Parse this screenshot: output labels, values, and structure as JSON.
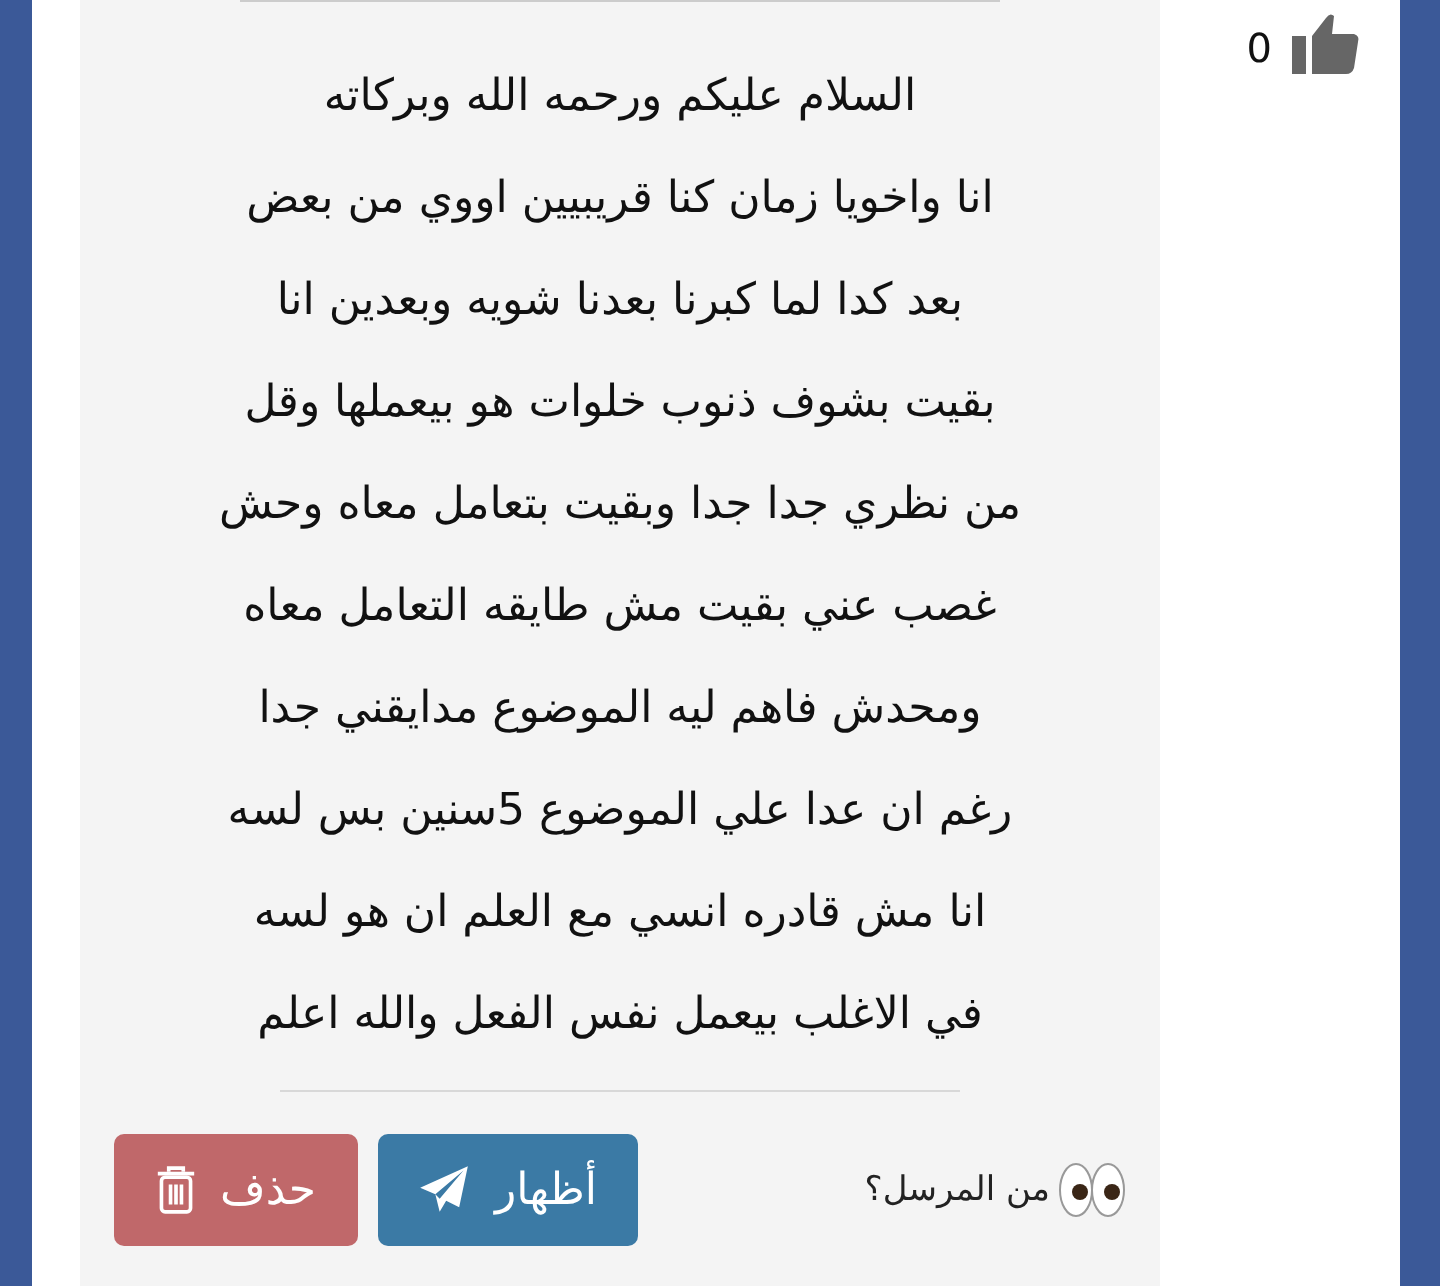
{
  "message": {
    "lines": [
      "السلام عليكم ورحمه الله وبركاته",
      "انا واخويا زمان كنا قريبيين اووي من بعض",
      "بعد كدا لما كبرنا بعدنا شويه وبعدين انا",
      "بقيت بشوف ذنوب خلوات هو بيعملها وقل",
      "من نظري جدا جدا وبقيت بتعامل معاه وحش",
      "غصب عني بقيت مش طايقه التعامل معاه",
      "ومحدش فاهم ليه الموضوع مدايقني جدا",
      "رغم ان عدا علي الموضوع 5سنين بس لسه",
      "انا مش قادره انسي مع العلم ان هو لسه",
      "في الاغلب بيعمل نفس الفعل والله اعلم"
    ]
  },
  "sender": {
    "label": "من المرسل؟"
  },
  "buttons": [
    {
      "kind": "show",
      "label": "أظهار"
    },
    {
      "kind": "delete",
      "label": "حذف"
    }
  ],
  "likes": {
    "count": "0"
  }
}
